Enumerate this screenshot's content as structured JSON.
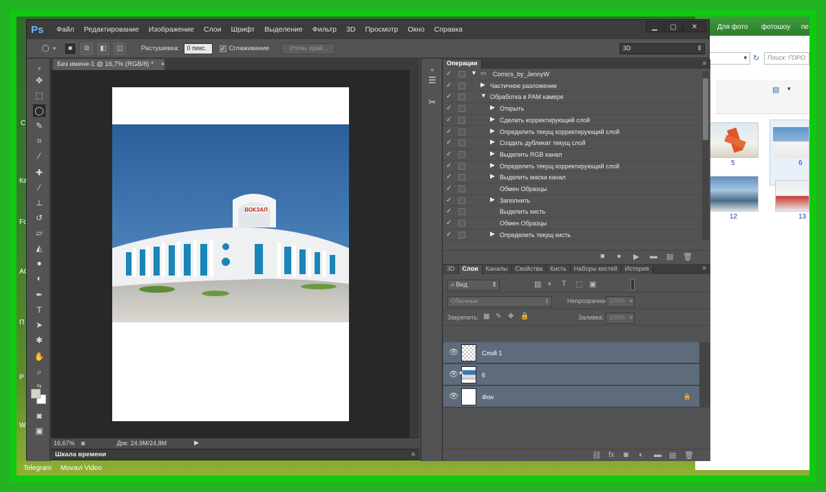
{
  "desktop": {
    "taskbar_items": [
      "Telegram",
      "Movavi Video"
    ]
  },
  "explorer": {
    "links": [
      "Для фото",
      "фотошоу",
      "пе"
    ],
    "search_placeholder": "Поиск: ГОРО",
    "thumbnails": [
      {
        "label": "5"
      },
      {
        "label": "6"
      },
      {
        "label": "12"
      },
      {
        "label": "13"
      }
    ]
  },
  "app": {
    "logo": "Ps",
    "menu": [
      "Файл",
      "Редактирование",
      "Изображение",
      "Слои",
      "Шрифт",
      "Выделение",
      "Фильтр",
      "3D",
      "Просмотр",
      "Окно",
      "Справка"
    ],
    "window_buttons": {
      "minimize": "▁",
      "maximize": "▢",
      "close": "✕"
    }
  },
  "options": {
    "feather_label": "Растушевка:",
    "feather_value": "0 пикс.",
    "antialias_label": "Сглаживание",
    "antialias_checked": true,
    "refine_button": "Уточн. край...",
    "workspace": "3D"
  },
  "document": {
    "tab_title": "Без имени-1 @ 16,7% (RGB/8) *",
    "zoom": "16,67%",
    "doc_info": "Док: 24,9M/24,8M",
    "photo_sign": "ВОКЗАЛ",
    "timeline_label": "Шкала времени"
  },
  "actions_panel": {
    "title": "Операции",
    "rows": [
      {
        "label": "Comics_by_JennyW",
        "level": 0,
        "expanded": true,
        "folder": true
      },
      {
        "label": "Частичное разложение",
        "level": 1,
        "expanded": false
      },
      {
        "label": "Обработка в РАМ камере",
        "level": 1,
        "expanded": true
      },
      {
        "label": "Открыть",
        "level": 2,
        "expanded": false
      },
      {
        "label": "Сделать корректирующий слой",
        "level": 2,
        "expanded": false
      },
      {
        "label": "Определить текущ корректирующий слой",
        "level": 2,
        "expanded": false
      },
      {
        "label": "Создать дубликат текущ слой",
        "level": 2,
        "expanded": false
      },
      {
        "label": "Выделить RGB канал",
        "level": 2,
        "expanded": false
      },
      {
        "label": "Определить текущ корректирующий слой",
        "level": 2,
        "expanded": false
      },
      {
        "label": "Выделить маска канал",
        "level": 2,
        "expanded": false
      },
      {
        "label": "Обмен Образцы",
        "level": 2,
        "expanded": null
      },
      {
        "label": "Заполнить",
        "level": 2,
        "expanded": false
      },
      {
        "label": "Выделить кисть",
        "level": 2,
        "expanded": null
      },
      {
        "label": "Обмен Образцы",
        "level": 2,
        "expanded": null
      },
      {
        "label": "Определить текущ кисть",
        "level": 2,
        "expanded": false
      }
    ]
  },
  "layers_panel": {
    "tabs": [
      "3D",
      "Слои",
      "Каналы",
      "Свойства",
      "Кисть",
      "Наборы кистей",
      "История"
    ],
    "active_tab": "Слои",
    "filter_kind": "Вид",
    "blend_mode": "Обычные",
    "opacity_label": "Непрозрачность:",
    "opacity_value": "100%",
    "lock_label": "Закрепить:",
    "fill_label": "Заливка:",
    "fill_value": "100%",
    "layers": [
      {
        "name": "Слой 1",
        "thumb": "transparent"
      },
      {
        "name": "6",
        "thumb": "photo"
      },
      {
        "name": "Фон",
        "thumb": "white",
        "locked": true
      }
    ]
  },
  "colors": {
    "frame_green": "#22b322",
    "ps_dark": "#3c3c3c",
    "ps_panel": "#535353",
    "layer_selected": "#5e6b7b",
    "sky": "#2f6ea8"
  }
}
